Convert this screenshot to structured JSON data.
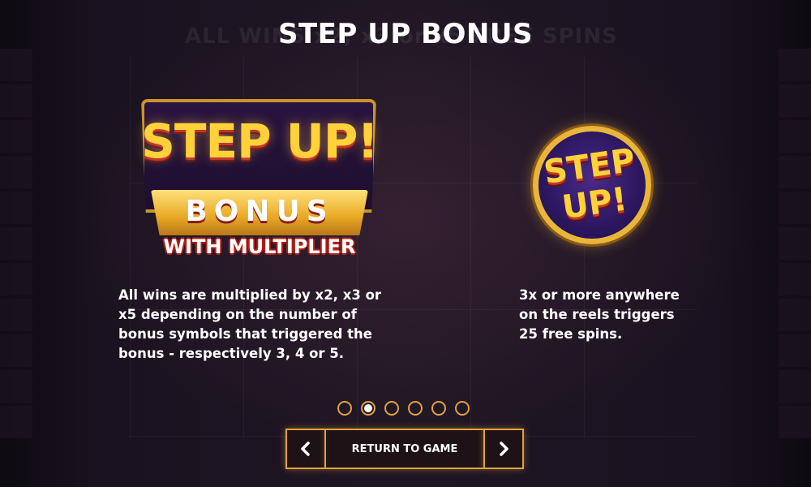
{
  "page": {
    "title": "STEP UP BONUS",
    "background_title": "ALL WINS x2, x3 or x5 FREE SPINS"
  },
  "left_panel": {
    "logo": {
      "line1": "STEP UP!",
      "line2": "BONUS",
      "line3": "WITH MULTIPLIER"
    },
    "description": "All wins are multiplied by x2, x3 or\nx5 depending on the number of\nbonus symbols that triggered the\nbonus -  respectively 3, 4 or 5."
  },
  "right_panel": {
    "coin": {
      "text": "STEP\nUP!"
    },
    "description": "3x or more anywhere\non the reels triggers\n25 free spins."
  },
  "pagination": {
    "total_pages": 6,
    "current_page": 2
  },
  "navigation": {
    "prev_icon": "chevron-left-icon",
    "next_icon": "chevron-right-icon",
    "return_label": "RETURN TO GAME"
  },
  "colors": {
    "accent_gold": "#e2a23a",
    "logo_yellow": "#ffd23a",
    "logo_red": "#c0392b",
    "coin_purple": "#2c1760"
  }
}
